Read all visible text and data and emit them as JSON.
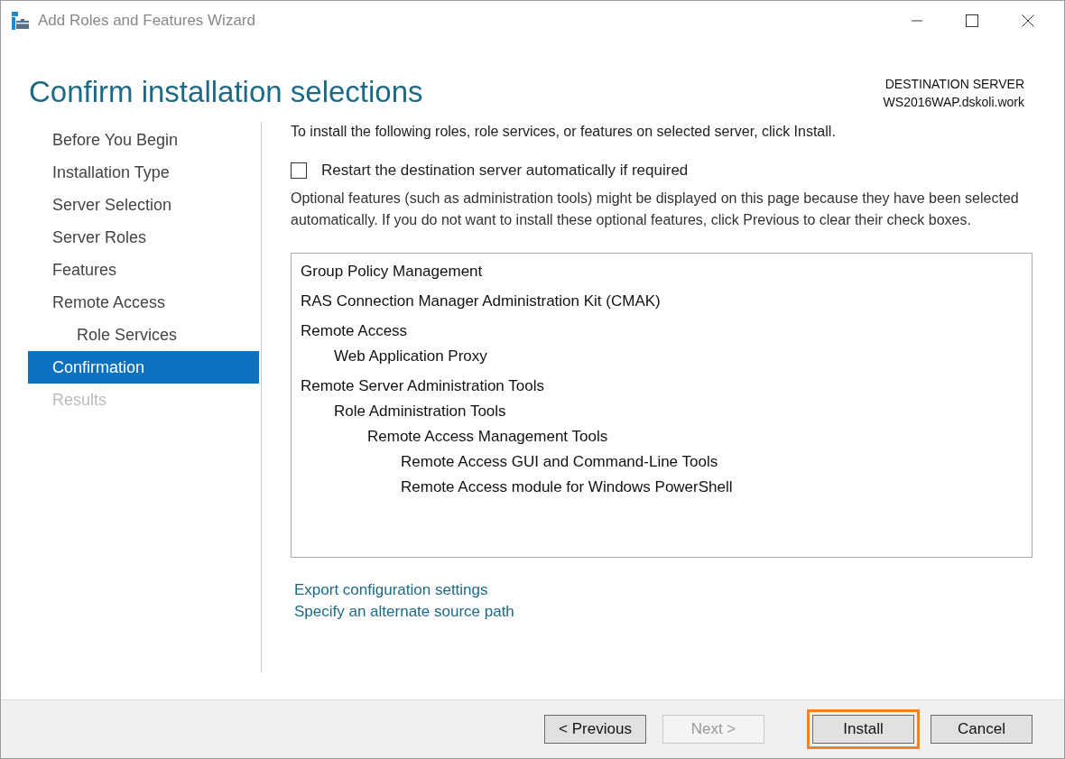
{
  "window": {
    "title": "Add Roles and Features Wizard"
  },
  "page_title": "Confirm installation selections",
  "destination": {
    "label": "DESTINATION SERVER",
    "server": "WS2016WAP.dskoli.work"
  },
  "nav": [
    {
      "label": "Before You Begin",
      "selected": false,
      "disabled": false
    },
    {
      "label": "Installation Type",
      "selected": false,
      "disabled": false
    },
    {
      "label": "Server Selection",
      "selected": false,
      "disabled": false
    },
    {
      "label": "Server Roles",
      "selected": false,
      "disabled": false
    },
    {
      "label": "Features",
      "selected": false,
      "disabled": false
    },
    {
      "label": "Remote Access",
      "selected": false,
      "disabled": false,
      "children": [
        {
          "label": "Role Services",
          "selected": false,
          "disabled": false
        }
      ]
    },
    {
      "label": "Confirmation",
      "selected": true,
      "disabled": false
    },
    {
      "label": "Results",
      "selected": false,
      "disabled": true
    }
  ],
  "intro": "To install the following roles, role services, or features on selected server, click Install.",
  "restart_checkbox": {
    "label": "Restart the destination server automatically if required",
    "checked": false
  },
  "note": "Optional features (such as administration tools) might be displayed on this page because they have been selected automatically. If you do not want to install these optional features, click Previous to clear their check boxes.",
  "features": [
    {
      "label": "Group Policy Management"
    },
    {
      "label": "RAS Connection Manager Administration Kit (CMAK)"
    },
    {
      "label": "Remote Access",
      "children": [
        {
          "label": "Web Application Proxy"
        }
      ]
    },
    {
      "label": "Remote Server Administration Tools",
      "children": [
        {
          "label": "Role Administration Tools",
          "children": [
            {
              "label": "Remote Access Management Tools",
              "children": [
                {
                  "label": "Remote Access GUI and Command-Line Tools"
                },
                {
                  "label": "Remote Access module for Windows PowerShell"
                }
              ]
            }
          ]
        }
      ]
    }
  ],
  "links": [
    "Export configuration settings",
    "Specify an alternate source path"
  ],
  "buttons": [
    {
      "label": "< Previous",
      "disabled": false,
      "highlighted": false
    },
    {
      "label": "Next >",
      "disabled": true,
      "highlighted": false
    },
    {
      "label": "Install",
      "disabled": false,
      "highlighted": true
    },
    {
      "label": "Cancel",
      "disabled": false,
      "highlighted": false
    }
  ]
}
